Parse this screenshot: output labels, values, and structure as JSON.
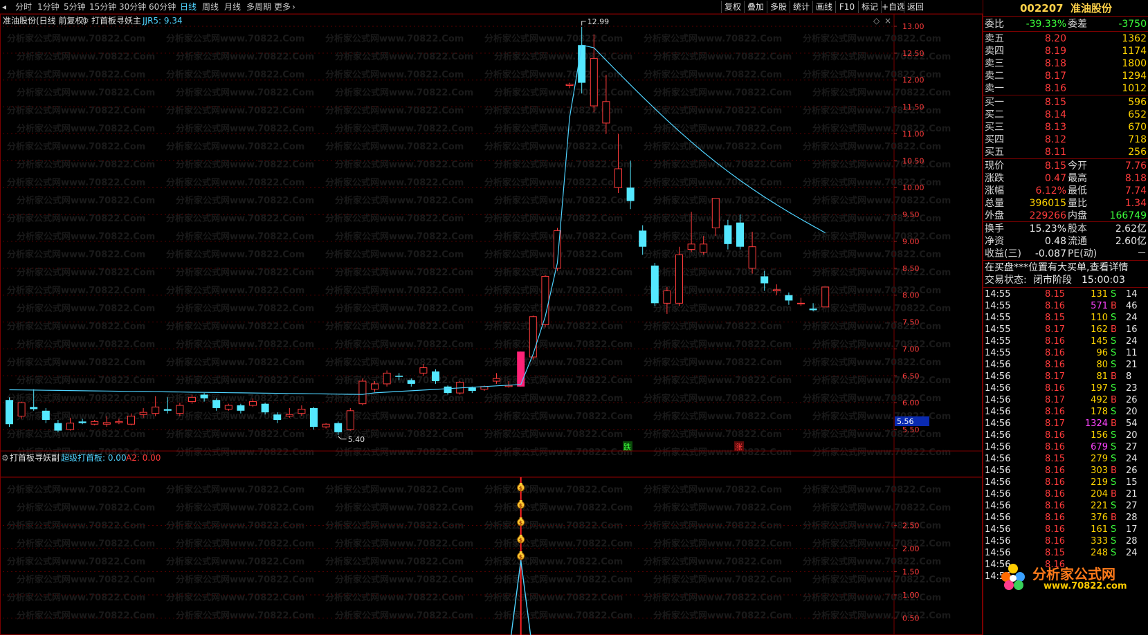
{
  "toolbar": {
    "periods": [
      {
        "label": "分时",
        "active": false
      },
      {
        "label": "1分钟",
        "active": false
      },
      {
        "label": "5分钟",
        "active": false
      },
      {
        "label": "15分钟",
        "active": false
      },
      {
        "label": "30分钟",
        "active": false
      },
      {
        "label": "60分钟",
        "active": false
      },
      {
        "label": "日线",
        "active": true
      },
      {
        "label": "周线",
        "active": false
      },
      {
        "label": "月线",
        "active": false
      },
      {
        "label": "多周期",
        "active": false
      },
      {
        "label": "更多",
        "active": false
      }
    ],
    "tools": [
      "复权",
      "叠加",
      "多股",
      "统计",
      "画线",
      "F10",
      "标记",
      "+自选",
      "返回"
    ]
  },
  "main_chart": {
    "stock_label": "准油股份(日线 前复权)",
    "indicator_name": "打首板寻妖主",
    "indicator_value": "JJR5: 9.34",
    "high_label": "12.99",
    "low_label": "5.40",
    "cursor_price": "5.56",
    "marker_down": "跌",
    "marker_up": "涨",
    "price_ticks": [
      "13.00",
      "12.50",
      "12.00",
      "11.50",
      "11.00",
      "10.50",
      "10.00",
      "9.50",
      "9.00",
      "8.50",
      "8.00",
      "7.50",
      "7.00",
      "6.50",
      "6.00",
      "5.50"
    ],
    "watermark": "分析家公式网www.70822.Com"
  },
  "sub_chart": {
    "indicator_name": "打首板寻妖副",
    "value1": "超级打首板: 0.00",
    "value2": "A2: 0.00",
    "ticks": [
      "2.50",
      "2.00",
      "1.50",
      "1.00",
      "0.50"
    ]
  },
  "chart_data": {
    "type": "candlestick",
    "ylim": [
      5.3,
      13.2
    ],
    "candles": [
      [
        6.05,
        5.6,
        6.1,
        5.55
      ],
      [
        5.75,
        6.0,
        6.02,
        5.7
      ],
      [
        5.92,
        5.88,
        6.25,
        5.85
      ],
      [
        5.85,
        5.68,
        5.9,
        5.62
      ],
      [
        5.62,
        5.48,
        5.68,
        5.45
      ],
      [
        5.5,
        5.62,
        5.72,
        5.48
      ],
      [
        5.65,
        5.62,
        5.7,
        5.6
      ],
      [
        5.6,
        5.65,
        5.68,
        5.58
      ],
      [
        5.6,
        5.63,
        5.75,
        5.55
      ],
      [
        5.63,
        5.65,
        5.7,
        5.6
      ],
      [
        5.6,
        5.75,
        5.8,
        5.58
      ],
      [
        5.78,
        5.82,
        5.9,
        5.72
      ],
      [
        5.8,
        5.92,
        6.12,
        5.75
      ],
      [
        5.88,
        5.85,
        6.1,
        5.8
      ],
      [
        5.8,
        5.95,
        6.0,
        5.75
      ],
      [
        6.02,
        6.1,
        6.15,
        5.98
      ],
      [
        6.15,
        6.08,
        6.18,
        6.02
      ],
      [
        6.05,
        5.9,
        6.08,
        5.85
      ],
      [
        5.88,
        5.95,
        5.98,
        5.85
      ],
      [
        5.95,
        5.85,
        5.98,
        5.8
      ],
      [
        5.95,
        6.02,
        6.08,
        5.92
      ],
      [
        5.98,
        5.82,
        6.0,
        5.78
      ],
      [
        5.78,
        5.68,
        5.82,
        5.62
      ],
      [
        5.75,
        5.78,
        5.9,
        5.72
      ],
      [
        5.8,
        5.88,
        5.95,
        5.75
      ],
      [
        5.9,
        5.55,
        5.92,
        5.5
      ],
      [
        5.55,
        5.6,
        5.62,
        5.52
      ],
      [
        5.62,
        5.45,
        5.65,
        5.4
      ],
      [
        5.5,
        5.85,
        5.9,
        5.48
      ],
      [
        5.98,
        6.4,
        6.45,
        5.95
      ],
      [
        6.25,
        6.35,
        6.4,
        6.2
      ],
      [
        6.35,
        6.55,
        6.6,
        6.3
      ],
      [
        6.5,
        6.48,
        6.55,
        6.42
      ],
      [
        6.42,
        6.35,
        6.45,
        6.3
      ],
      [
        6.55,
        6.65,
        6.72,
        6.5
      ],
      [
        6.58,
        6.4,
        6.62,
        6.35
      ],
      [
        6.3,
        6.18,
        6.32,
        6.15
      ],
      [
        6.18,
        6.38,
        6.4,
        6.15
      ],
      [
        6.28,
        6.22,
        6.3,
        6.18
      ],
      [
        6.25,
        6.3,
        6.32,
        6.22
      ],
      [
        6.4,
        6.45,
        6.55,
        6.35
      ],
      [
        6.3,
        6.32,
        6.4,
        6.28
      ],
      [
        6.3,
        6.95,
        6.95,
        6.3
      ],
      [
        6.85,
        7.6,
        7.62,
        6.8
      ],
      [
        7.45,
        8.35,
        8.38,
        7.4
      ],
      [
        8.5,
        9.2,
        9.25,
        8.45
      ],
      [
        11.9,
        11.92,
        11.95,
        11.85
      ],
      [
        12.65,
        11.95,
        12.99,
        11.75
      ],
      [
        11.52,
        12.4,
        12.85,
        11.4
      ],
      [
        11.2,
        11.6,
        12.1,
        11.0
      ],
      [
        10.0,
        10.35,
        11.0,
        9.9
      ],
      [
        10.0,
        9.75,
        10.5,
        9.6
      ],
      [
        9.2,
        8.9,
        9.3,
        8.75
      ],
      [
        8.55,
        7.85,
        8.6,
        7.8
      ],
      [
        7.85,
        8.08,
        8.15,
        7.65
      ],
      [
        7.85,
        8.75,
        8.9,
        7.8
      ],
      [
        8.85,
        8.95,
        9.55,
        8.8
      ],
      [
        8.8,
        8.95,
        9.1,
        8.75
      ],
      [
        9.25,
        9.8,
        9.8,
        9.1
      ],
      [
        9.3,
        8.95,
        9.4,
        8.85
      ],
      [
        9.35,
        8.9,
        9.5,
        8.85
      ],
      [
        8.5,
        8.9,
        9.18,
        8.4
      ],
      [
        8.35,
        8.22,
        8.45,
        8.08
      ],
      [
        8.08,
        8.1,
        8.2,
        8.0
      ],
      [
        8.0,
        7.9,
        8.05,
        7.82
      ],
      [
        7.85,
        7.85,
        7.95,
        7.8
      ],
      [
        7.75,
        7.72,
        7.85,
        7.7
      ],
      [
        7.78,
        8.15,
        8.15,
        7.78
      ]
    ],
    "limit_up_index": 42
  },
  "panel": {
    "code": "002207",
    "name": "准油股份",
    "weibi_label": "委比",
    "weibi": "-39.33%",
    "weicha_label": "委差",
    "weicha": "-3750",
    "asks": [
      {
        "label": "卖五",
        "price": "8.20",
        "vol": "1362"
      },
      {
        "label": "卖四",
        "price": "8.19",
        "vol": "1174"
      },
      {
        "label": "卖三",
        "price": "8.18",
        "vol": "1800"
      },
      {
        "label": "卖二",
        "price": "8.17",
        "vol": "1294"
      },
      {
        "label": "卖一",
        "price": "8.16",
        "vol": "1012"
      }
    ],
    "bids": [
      {
        "label": "买一",
        "price": "8.15",
        "vol": "596"
      },
      {
        "label": "买二",
        "price": "8.14",
        "vol": "652"
      },
      {
        "label": "买三",
        "price": "8.13",
        "vol": "670"
      },
      {
        "label": "买四",
        "price": "8.12",
        "vol": "718"
      },
      {
        "label": "买五",
        "price": "8.11",
        "vol": "256"
      }
    ],
    "stats": [
      {
        "l1": "现价",
        "v1": "8.15",
        "c1": "red",
        "l2": "今开",
        "v2": "7.76",
        "c2": "red"
      },
      {
        "l1": "涨跌",
        "v1": "0.47",
        "c1": "red",
        "l2": "最高",
        "v2": "8.18",
        "c2": "red"
      },
      {
        "l1": "涨幅",
        "v1": "6.12%",
        "c1": "red",
        "l2": "最低",
        "v2": "7.74",
        "c2": "red"
      },
      {
        "l1": "总量",
        "v1": "396015",
        "c1": "yellow",
        "l2": "量比",
        "v2": "1.34",
        "c2": "red"
      },
      {
        "l1": "外盘",
        "v1": "229266",
        "c1": "red",
        "l2": "内盘",
        "v2": "166749",
        "c2": "green"
      }
    ],
    "fin": [
      {
        "l1": "换手",
        "v1": "15.23%",
        "l2": "股本",
        "v2": "2.62亿"
      },
      {
        "l1": "净资",
        "v1": "0.48",
        "l2": "流通",
        "v2": "2.60亿"
      },
      {
        "l1": "收益(三)",
        "v1": "-0.087",
        "l2": "PE(动)",
        "v2": "－"
      }
    ],
    "notice": "在买盘***位置有大买单,查看详情",
    "trade_state_label": "交易状态:",
    "trade_state": "闭市阶段",
    "trade_time": "15:00:03",
    "ticks": [
      [
        "14:55",
        "8.15",
        "131",
        "S",
        "14"
      ],
      [
        "14:55",
        "8.16",
        "571",
        "B",
        "46"
      ],
      [
        "14:55",
        "8.15",
        "110",
        "S",
        "24"
      ],
      [
        "14:55",
        "8.17",
        "162",
        "B",
        "16"
      ],
      [
        "14:55",
        "8.16",
        "145",
        "S",
        "24"
      ],
      [
        "14:55",
        "8.16",
        "96",
        "S",
        "11"
      ],
      [
        "14:56",
        "8.16",
        "80",
        "S",
        "21"
      ],
      [
        "14:56",
        "8.17",
        "81",
        "B",
        "8"
      ],
      [
        "14:56",
        "8.16",
        "197",
        "S",
        "23"
      ],
      [
        "14:56",
        "8.17",
        "492",
        "B",
        "26"
      ],
      [
        "14:56",
        "8.16",
        "178",
        "S",
        "20"
      ],
      [
        "14:56",
        "8.17",
        "1324",
        "B",
        "54"
      ],
      [
        "14:56",
        "8.16",
        "156",
        "S",
        "20"
      ],
      [
        "14:56",
        "8.16",
        "679",
        "S",
        "27"
      ],
      [
        "14:56",
        "8.15",
        "279",
        "S",
        "24"
      ],
      [
        "14:56",
        "8.16",
        "303",
        "B",
        "26"
      ],
      [
        "14:56",
        "8.16",
        "219",
        "S",
        "15"
      ],
      [
        "14:56",
        "8.16",
        "204",
        "B",
        "21"
      ],
      [
        "14:56",
        "8.16",
        "221",
        "S",
        "27"
      ],
      [
        "14:56",
        "8.16",
        "376",
        "B",
        "28"
      ],
      [
        "14:56",
        "8.16",
        "161",
        "S",
        "17"
      ],
      [
        "14:56",
        "8.16",
        "333",
        "S",
        "28"
      ],
      [
        "14:56",
        "8.15",
        "248",
        "S",
        "24"
      ],
      [
        "14:56",
        "8.16",
        "",
        "",
        ""
      ],
      [
        "14:56",
        "",
        "",
        "",
        ""
      ]
    ]
  },
  "logo": {
    "text": "分析家公式网",
    "url": "www.70822.com"
  }
}
